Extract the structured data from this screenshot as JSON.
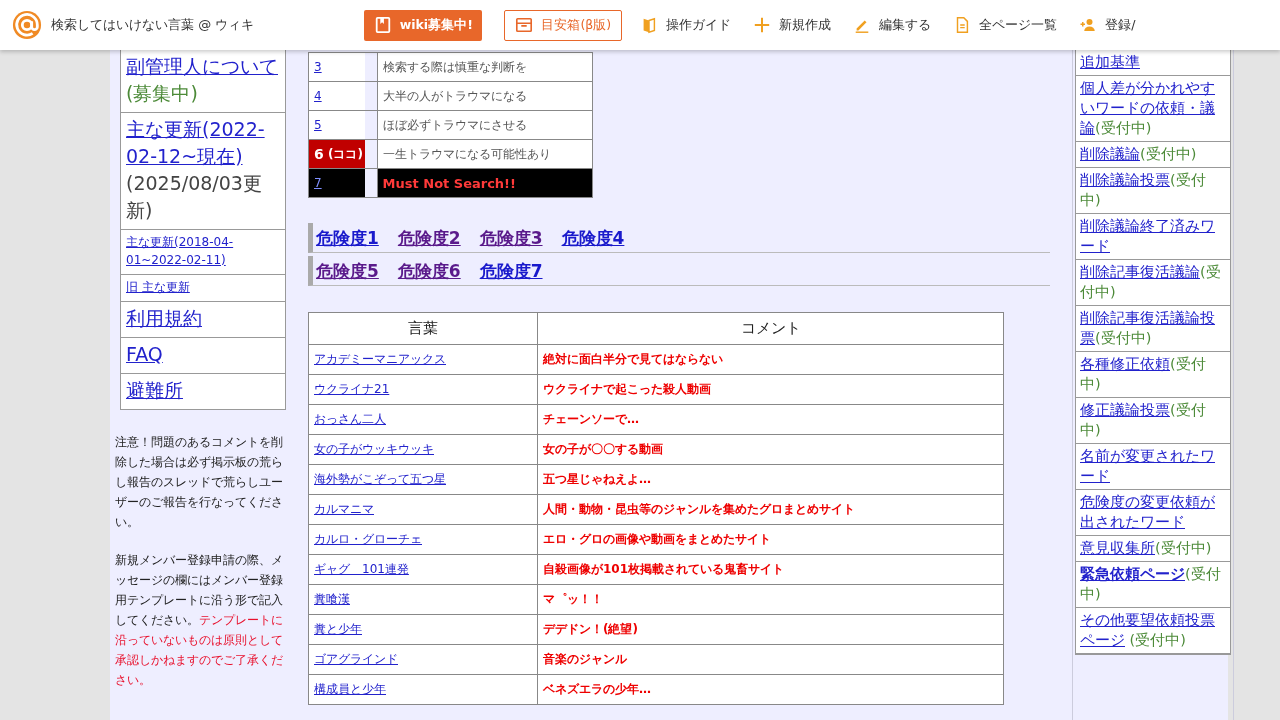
{
  "header": {
    "title": "検索してはいけない言葉 @ ウィキ",
    "actions": [
      {
        "label": "wiki募集中!",
        "kind": "primary"
      },
      {
        "label": "目安箱(β版)",
        "kind": "outline"
      },
      {
        "label": "操作ガイド",
        "kind": "plain"
      },
      {
        "label": "新規作成",
        "kind": "plain"
      },
      {
        "label": "編集する",
        "kind": "plain"
      },
      {
        "label": "全ページ一覧",
        "kind": "plain"
      },
      {
        "label": "登録/",
        "kind": "plain"
      }
    ]
  },
  "left_menu": [
    {
      "link": "副管理人について",
      "status": "(募集中)",
      "kind": "large"
    },
    {
      "link": "主な更新(2022-02-12~現在)",
      "note": "(2025/08/03更新)",
      "kind": "large"
    },
    {
      "link": "主な更新(2018-04-01~2022-02-11)",
      "kind": "small"
    },
    {
      "link": "旧 主な更新",
      "kind": "small"
    },
    {
      "link": "利用規約",
      "kind": "large"
    },
    {
      "link": "FAQ",
      "kind": "large"
    },
    {
      "link": "避難所",
      "kind": "large"
    }
  ],
  "notice": [
    {
      "text": "注意！問題のあるコメントを削除した場合は必ず掲示板の荒らし報告のスレッドで荒らしユーザーのご報告を行なってください。"
    },
    {
      "text": "新規メンバー登録申請の際、メッセージの欄にはメンバー登録用テンプレートに沿う形で記入してください。",
      "warning": "テンプレートに沿っていないものは原則として承認しかねますのでご了承ください。"
    }
  ],
  "danger_levels": [
    {
      "level": "3",
      "description": "検索する際は慎重な判断を",
      "kind": "normal"
    },
    {
      "level": "4",
      "description": "大半の人がトラウマになる",
      "kind": "normal"
    },
    {
      "level": "5",
      "description": "ほぼ必ずトラウマにさせる",
      "kind": "normal"
    },
    {
      "level": "6",
      "marker": "(ココ)",
      "description": "一生トラウマになる可能性あり",
      "kind": "current"
    },
    {
      "level": "7",
      "description": "Must Not Search!!",
      "kind": "max"
    }
  ],
  "level_links": [
    [
      {
        "label": "危険度1",
        "visited": false
      },
      {
        "label": "危険度2",
        "visited": true
      },
      {
        "label": "危険度3",
        "visited": true
      },
      {
        "label": "危険度4",
        "visited": false
      }
    ],
    [
      {
        "label": "危険度5",
        "visited": true
      },
      {
        "label": "危険度6",
        "visited": true
      },
      {
        "label": "危険度7",
        "visited": false
      }
    ]
  ],
  "table": {
    "columns": [
      "言葉",
      "コメント"
    ],
    "rows": [
      [
        "アカデミーマニアックス",
        "絶対に面白半分で見てはならない"
      ],
      [
        "ウクライナ21",
        "ウクライナで起こった殺人動画"
      ],
      [
        "おっさん二人",
        "チェーンソーで…"
      ],
      [
        "女の子がウッキウッキ",
        "女の子が〇〇する動画"
      ],
      [
        "海外勢がこぞって五つ星",
        "五つ星じゃねえよ…"
      ],
      [
        "カルマニマ",
        "人間・動物・昆虫等のジャンルを集めたグロまとめサイト"
      ],
      [
        "カルロ・グローチェ",
        "エロ・グロの画像や動画をまとめたサイト"
      ],
      [
        "ギャグ　101連発",
        "自殺画像が101枚掲載されている鬼畜サイト"
      ],
      [
        "糞喰漢",
        "マ゜ッ！！"
      ],
      [
        "糞と少年",
        "デデドン！(絶望)"
      ],
      [
        "ゴアグラインド",
        "音楽のジャンル"
      ],
      [
        "構成員と少年",
        "ベネズエラの少年…"
      ]
    ]
  },
  "right_menu": [
    {
      "link": "追加基準",
      "bold": false
    },
    {
      "link": "個人差が分かれやすいワードの依頼・議論",
      "status": "(受付中)",
      "bold": false
    },
    {
      "link": "削除議論",
      "status": "(受付中)",
      "bold": false
    },
    {
      "link": "削除議論投票",
      "status": "(受付中)",
      "bold": false
    },
    {
      "link": "削除議論終了済みワード",
      "bold": false
    },
    {
      "link": "削除記事復活議論",
      "status": "(受付中)",
      "bold": false
    },
    {
      "link": "削除記事復活議論投票",
      "status": "(受付中)",
      "bold": false
    },
    {
      "link": "各種修正依頼",
      "status": "(受付中)",
      "bold": false
    },
    {
      "link": "修正議論投票",
      "status": "(受付中)",
      "bold": false
    },
    {
      "link": "名前が変更されたワード",
      "bold": false
    },
    {
      "link": "危険度の変更依頼が出されたワード",
      "bold": false
    },
    {
      "link": "意見収集所",
      "status": "(受付中)",
      "bold": false
    },
    {
      "link": "緊急依頼ページ",
      "status": "(受付中)",
      "bold": true
    },
    {
      "link": "その他要望依頼投票ページ",
      "status": " (受付中)",
      "bold": false
    }
  ]
}
